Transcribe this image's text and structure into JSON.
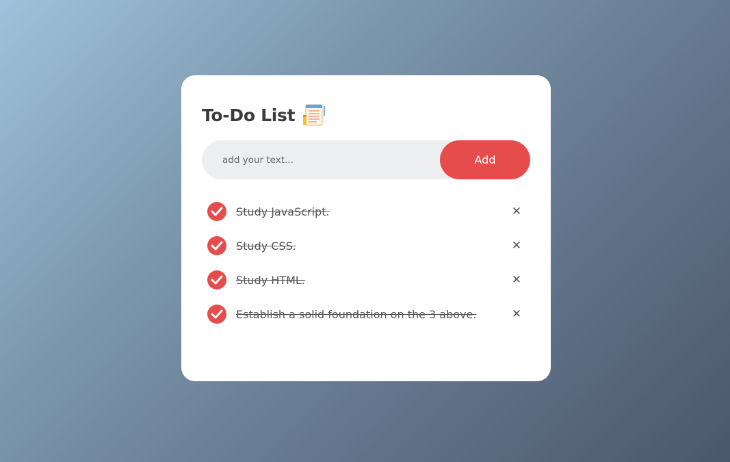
{
  "app": {
    "title": "To-Do List",
    "title_icon": "notepad-icon"
  },
  "input": {
    "placeholder": "add your text...",
    "value": ""
  },
  "add_button": {
    "label": "Add"
  },
  "tasks": [
    {
      "text": "Study JavaScript.",
      "checked": true,
      "remove_icon": "✕"
    },
    {
      "text": "Study CSS.",
      "checked": true,
      "remove_icon": "✕"
    },
    {
      "text": "Study HTML.",
      "checked": true,
      "remove_icon": "✕"
    },
    {
      "text": "Establish a solid foundation on the 3 above.",
      "checked": true,
      "remove_icon": "✕"
    }
  ],
  "colors": {
    "accent": "#e64c4c",
    "card": "#ffffff",
    "input_bg": "#edeef0",
    "text": "#3b3b3b"
  }
}
